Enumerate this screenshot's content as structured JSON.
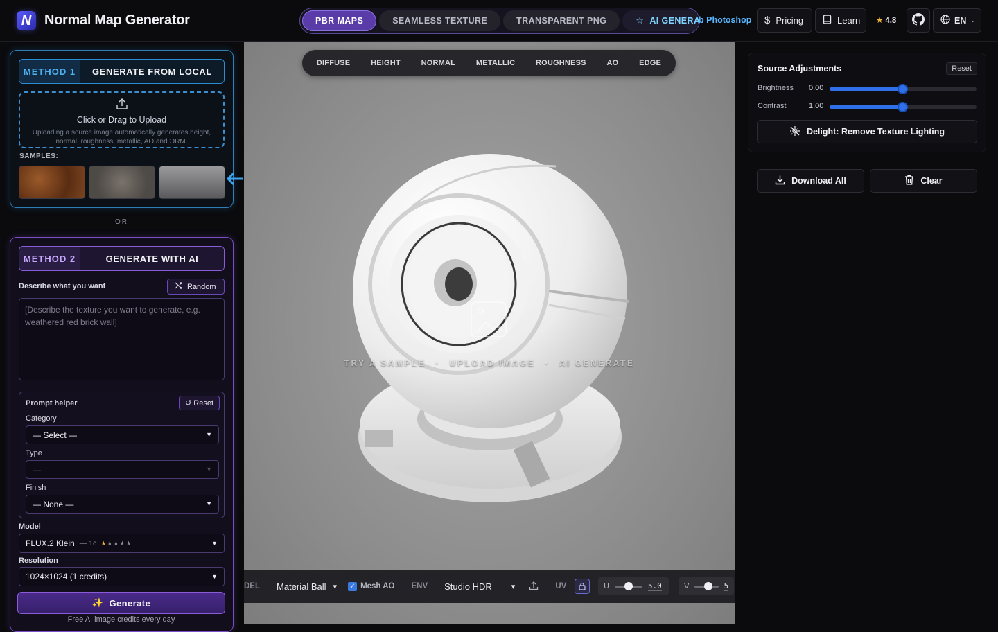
{
  "app": {
    "logo_letter": "N",
    "title": "Normal Map Generator"
  },
  "topnav": {
    "tabs": [
      {
        "label": "PBR MAPS",
        "active": true
      },
      {
        "label": "SEAMLESS TEXTURE",
        "active": false
      },
      {
        "label": "TRANSPARENT PNG",
        "active": false
      },
      {
        "label": "AI GENERATE",
        "active": false
      }
    ],
    "overflow_label": "b Photoshop",
    "pricing": "Pricing",
    "learn": "Learn",
    "rating": "4.8",
    "language": "EN"
  },
  "method1": {
    "number": "METHOD 1",
    "label": "GENERATE FROM LOCAL",
    "upload_title": "Click or Drag to Upload",
    "upload_subtitle": "Uploading a source image automatically generates height, normal, roughness, metallic, AO and ORM.",
    "samples_label": "SAMPLES:"
  },
  "or_label": "OR",
  "method2": {
    "number": "METHOD 2",
    "label": "GENERATE WITH AI",
    "describe_label": "Describe what you want",
    "random_label": "Random",
    "prompt_placeholder": "[Describe the texture you want to generate, e.g. weathered red brick wall]",
    "prompt_helper": {
      "title": "Prompt helper",
      "reset_label": "↺ Reset",
      "category_label": "Category",
      "category_value": "— Select —",
      "type_label": "Type",
      "type_value": "—",
      "finish_label": "Finish",
      "finish_value": "— None —"
    },
    "model_label": "Model",
    "model_value": "FLUX.2 Klein",
    "model_cost": "— 1c",
    "model_stars": {
      "filled": 1,
      "total": 5
    },
    "resolution_label": "Resolution",
    "resolution_value": "1024×1024 (1 credits)",
    "generate_label": "Generate",
    "free_note": "Free AI image credits every day"
  },
  "viewport": {
    "map_tabs": [
      "DIFFUSE",
      "HEIGHT",
      "NORMAL",
      "METALLIC",
      "ROUGHNESS",
      "AO",
      "EDGE"
    ],
    "overlay": [
      "TRY A SAMPLE",
      "UPLOAD IMAGE",
      "AI GENERATE"
    ],
    "bottombar": {
      "model_label": "DEL",
      "model_value": "Material Ball",
      "mesh_ao_label": "Mesh AO",
      "mesh_ao_checked": true,
      "env_label": "ENV",
      "env_value": "Studio HDR",
      "uv_label": "UV",
      "u_label": "U",
      "u_value": "5.0",
      "v_label": "V",
      "v_value": "5"
    }
  },
  "source_adjustments": {
    "title": "Source Adjustments",
    "reset_label": "Reset",
    "brightness_label": "Brightness",
    "brightness_value": "0.00",
    "brightness_fraction": 0.5,
    "contrast_label": "Contrast",
    "contrast_value": "1.00",
    "contrast_fraction": 0.5,
    "delight_label": "Delight: Remove Texture Lighting"
  },
  "actions": {
    "download_all": "Download All",
    "clear": "Clear"
  },
  "colors": {
    "accent_blue": "#2f6fe8",
    "method1_border": "#2e7fb8",
    "method2_border": "#7a4cc8",
    "active_tab": "#5a3ca8",
    "star": "#f2b33a"
  }
}
